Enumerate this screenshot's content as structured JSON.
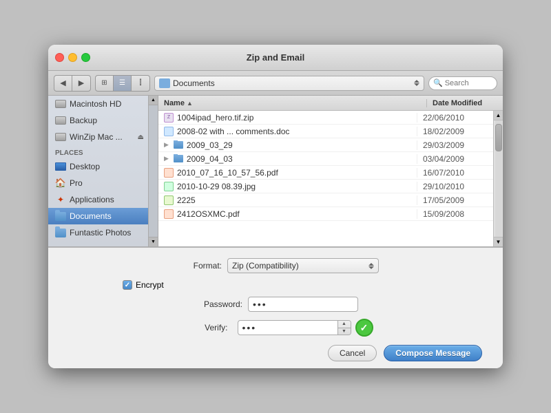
{
  "window": {
    "title": "Zip and Email"
  },
  "toolbar": {
    "location": "Documents",
    "search_placeholder": "Search"
  },
  "sidebar": {
    "places_label": "PLACES",
    "items": [
      {
        "label": "Macintosh HD",
        "icon": "hd"
      },
      {
        "label": "Backup",
        "icon": "hd"
      },
      {
        "label": "WinZip Mac ...",
        "icon": "hd"
      },
      {
        "label": "Desktop",
        "icon": "desktop"
      },
      {
        "label": "Pro",
        "icon": "home"
      },
      {
        "label": "Applications",
        "icon": "apps"
      },
      {
        "label": "Documents",
        "icon": "folder",
        "selected": true
      },
      {
        "label": "Funtastic Photos",
        "icon": "folder"
      }
    ]
  },
  "file_list": {
    "col_name": "Name",
    "col_date": "Date Modified",
    "files": [
      {
        "name": "1004ipad_hero.tif.zip",
        "date": "22/06/2010",
        "type": "zip",
        "indent": false,
        "is_folder": false
      },
      {
        "name": "2008-02 with ... comments.doc",
        "date": "18/02/2009",
        "type": "doc",
        "indent": false,
        "is_folder": false
      },
      {
        "name": "2009_03_29",
        "date": "29/03/2009",
        "type": "folder",
        "indent": false,
        "is_folder": true
      },
      {
        "name": "2009_04_03",
        "date": "03/04/2009",
        "type": "folder",
        "indent": false,
        "is_folder": true
      },
      {
        "name": "2010_07_16_10_57_56.pdf",
        "date": "16/07/2010",
        "type": "pdf",
        "indent": false,
        "is_folder": false
      },
      {
        "name": "2010-10-29 08.39.jpg",
        "date": "29/10/2010",
        "type": "jpg",
        "indent": false,
        "is_folder": false
      },
      {
        "name": "2225",
        "date": "17/05/2009",
        "type": "num",
        "indent": false,
        "is_folder": false
      },
      {
        "name": "2412OSXMC.pdf",
        "date": "15/09/2008",
        "type": "pdf",
        "indent": false,
        "is_folder": false
      }
    ]
  },
  "bottom_panel": {
    "format_label": "Format:",
    "format_value": "Zip (Compatibility)",
    "encrypt_label": "Encrypt",
    "encrypt_checked": true,
    "password_label": "Password:",
    "password_dots": "•••",
    "verify_label": "Verify:",
    "verify_dots": "•••",
    "cancel_label": "Cancel",
    "compose_label": "Compose Message"
  }
}
